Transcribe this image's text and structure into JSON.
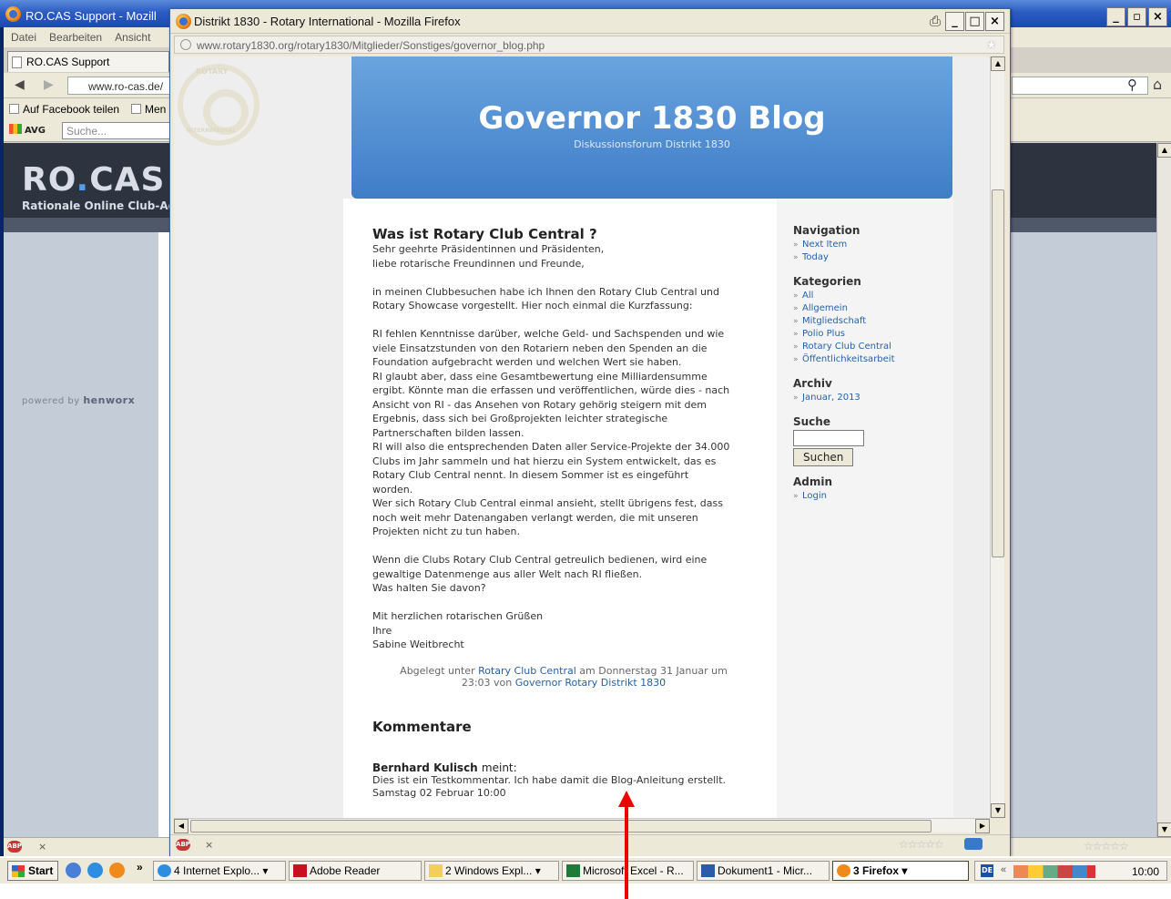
{
  "background_window": {
    "title": "RO.CAS Support - Mozill",
    "menu": [
      "Datei",
      "Bearbeiten",
      "Ansicht"
    ],
    "tab_label": "RO.CAS Support",
    "url": "www.ro-cas.de/",
    "bookmarks": [
      "Auf Facebook teilen",
      "Men"
    ],
    "avg_label": "AVG",
    "avg_search_placeholder": "Suche...",
    "logo_main": "RO",
    "logo_dot": ".",
    "logo_rest": "CAS",
    "logo_subtitle": "Rationale Online Club-Adm",
    "powered_by_prefix": "powered by",
    "powered_by_brand": "henworx",
    "status_close": "×"
  },
  "popup": {
    "title": "Distrikt 1830 - Rotary International - Mozilla Firefox",
    "url": "www.rotary1830.org/rotary1830/Mitglieder/Sonstiges/governor_blog.php",
    "status_close": "×"
  },
  "blog": {
    "title": "Governor 1830 Blog",
    "subtitle": "Diskussionsforum Distrikt 1830",
    "watermark_top": "ROTARY",
    "watermark_bottom": "INTERNATIONAL",
    "post": {
      "title": "Was ist Rotary Club Central ?",
      "greeting": "Sehr geehrte Präsidentinnen und Präsidenten,\nliebe rotarische Freundinnen und Freunde,",
      "para1": "in meinen Clubbesuchen habe ich Ihnen den Rotary Club Central und\nRotary Showcase vorgestellt. Hier noch einmal die Kurzfassung:",
      "para2": "RI fehlen Kenntnisse darüber, welche Geld- und Sachspenden und wie\nviele Einsatzstunden von den Rotariern neben den Spenden an die\nFoundation aufgebracht werden und welchen Wert sie haben.\nRI glaubt aber, dass eine Gesamtbewertung eine Milliardensumme\nergibt. Könnte man die erfassen und veröffentlichen, würde dies - nach\nAnsicht von RI - das Ansehen von Rotary gehörig steigern mit dem\nErgebnis, dass sich bei Großprojekten leichter strategische\nPartnerschaften bilden lassen.\nRI will also die entsprechenden Daten aller Service-Projekte der 34.000\nClubs im Jahr sammeln und hat hierzu ein System entwickelt, das es\nRotary Club Central nennt. In diesem Sommer ist es eingeführt\nworden.\nWer sich Rotary Club Central einmal ansieht, stellt übrigens fest, dass\nnoch weit mehr Datenangaben verlangt werden, die mit unseren\nProjekten nicht zu tun haben.",
      "para3": "Wenn die Clubs Rotary Club Central getreulich bedienen, wird eine\ngewaltige Datenmenge aus aller Welt nach RI fließen.\nWas halten Sie davon?",
      "closing": "Mit herzlichen rotarischen Grüßen\nIhre\nSabine Weitbrecht",
      "meta_prefix": "Abgelegt unter",
      "meta_category": "Rotary Club Central",
      "meta_mid": "am Donnerstag 31 Januar um",
      "meta_time": "23:03 von",
      "meta_author": "Governor Rotary Distrikt 1830"
    },
    "comments_heading": "Kommentare",
    "comment": {
      "author": "Bernhard Kulisch",
      "meint": "meint:",
      "text": "Dies ist ein Testkommentar. Ich habe damit die Blog-Anleitung erstellt.",
      "date": "Samstag 02 Februar 10:00"
    },
    "sidebar": {
      "navigation_title": "Navigation",
      "navigation": [
        "Next Item",
        "Today"
      ],
      "kategorien_title": "Kategorien",
      "kategorien": [
        "All",
        "Allgemein",
        "Mitgliedschaft",
        "Polio Plus",
        "Rotary Club Central",
        "Öffentlichkeitsarbeit"
      ],
      "archiv_title": "Archiv",
      "archiv": [
        "Januar, 2013"
      ],
      "suche_title": "Suche",
      "suche_button": "Suchen",
      "admin_title": "Admin",
      "admin": [
        "Login"
      ]
    }
  },
  "taskbar": {
    "start": "Start",
    "overflow": "»",
    "buttons": [
      "4 Internet Explo...",
      "Adobe Reader",
      "2 Windows Expl...",
      "Microsoft Excel - R...",
      "Dokument1 - Micr...",
      "3 Firefox"
    ],
    "tray_lang": "DE",
    "tray_overflow": "«",
    "clock": "10:00"
  }
}
